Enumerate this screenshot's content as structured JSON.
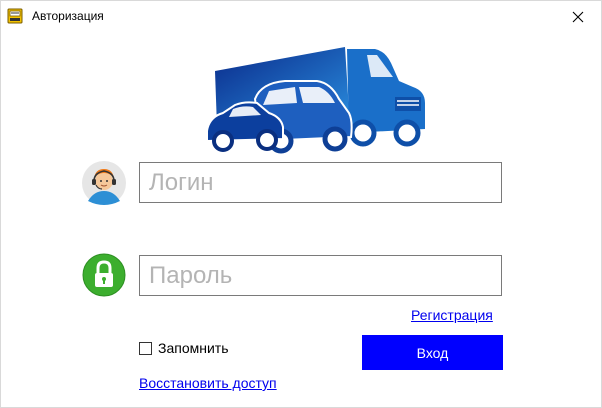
{
  "window": {
    "title": "Авторизация",
    "app_icon": "app-icon",
    "close_icon": "close-icon"
  },
  "logo": {
    "icon": "vehicles-logo-icon",
    "accent_color": "#1a6fc9"
  },
  "login": {
    "icon": "user-avatar-icon",
    "placeholder": "Логин",
    "value": ""
  },
  "password": {
    "icon": "lock-icon",
    "placeholder": "Пароль",
    "value": ""
  },
  "register_link": "Регистрация",
  "remember": {
    "label": "Запомнить",
    "checked": false
  },
  "login_button": {
    "label": "Вход",
    "color": "#0000ff"
  },
  "restore_link": "Восстановить доступ"
}
